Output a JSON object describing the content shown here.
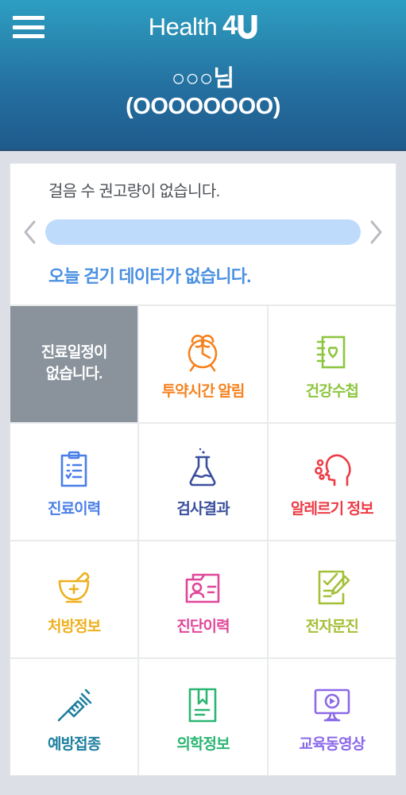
{
  "header": {
    "menu_icon": "hamburger-menu-icon",
    "brand_word": "Health",
    "brand_mark": "4U",
    "user_name": "○○○님",
    "user_id": "(OOOOOOOO)",
    "gradient_top": "#2e9ec2",
    "gradient_bottom": "#1f5a8c"
  },
  "steps": {
    "title": "걸음 수 권고량이 없습니다.",
    "prev_icon": "chevron-left-icon",
    "next_icon": "chevron-right-icon",
    "bar_color": "#bedbfb",
    "bar_value": 0,
    "message": "오늘 걷기 데이터가 없습니다.",
    "message_color": "#4a90e2"
  },
  "grid": {
    "tiles": [
      {
        "type": "placeholder",
        "label": "진료일정이\n없습니다.",
        "icon": "",
        "color": "#ffffff",
        "bg": "#8a929c"
      },
      {
        "type": "menu",
        "label": "투약시간 알림",
        "icon": "alarm-clock-icon",
        "color": "#f5821f",
        "bg": "#ffffff"
      },
      {
        "type": "menu",
        "label": "건강수첩",
        "icon": "health-notebook-heart-icon",
        "color": "#8cc63f",
        "bg": "#ffffff"
      },
      {
        "type": "menu",
        "label": "진료이력",
        "icon": "clipboard-checklist-icon",
        "color": "#4a7fe8",
        "bg": "#ffffff"
      },
      {
        "type": "menu",
        "label": "검사결과",
        "icon": "lab-flask-icon",
        "color": "#3b4f9e",
        "bg": "#ffffff"
      },
      {
        "type": "menu",
        "label": "알레르기 정보",
        "icon": "allergy-head-icon",
        "color": "#ed3b45",
        "bg": "#ffffff"
      },
      {
        "type": "menu",
        "label": "처방정보",
        "icon": "mortar-pestle-icon",
        "color": "#eeb01e",
        "bg": "#ffffff"
      },
      {
        "type": "menu",
        "label": "진단이력",
        "icon": "id-card-person-icon",
        "color": "#e0469a",
        "bg": "#ffffff"
      },
      {
        "type": "menu",
        "label": "전자문진",
        "icon": "survey-pen-icon",
        "color": "#a4c037",
        "bg": "#ffffff"
      },
      {
        "type": "menu",
        "label": "예방접종",
        "icon": "syringe-icon",
        "color": "#1e7f9e",
        "bg": "#ffffff"
      },
      {
        "type": "menu",
        "label": "의학정보",
        "icon": "book-bookmark-icon",
        "color": "#2bb673",
        "bg": "#ffffff"
      },
      {
        "type": "menu",
        "label": "교육동영상",
        "icon": "video-monitor-play-icon",
        "color": "#8c6ae8",
        "bg": "#ffffff"
      }
    ]
  }
}
